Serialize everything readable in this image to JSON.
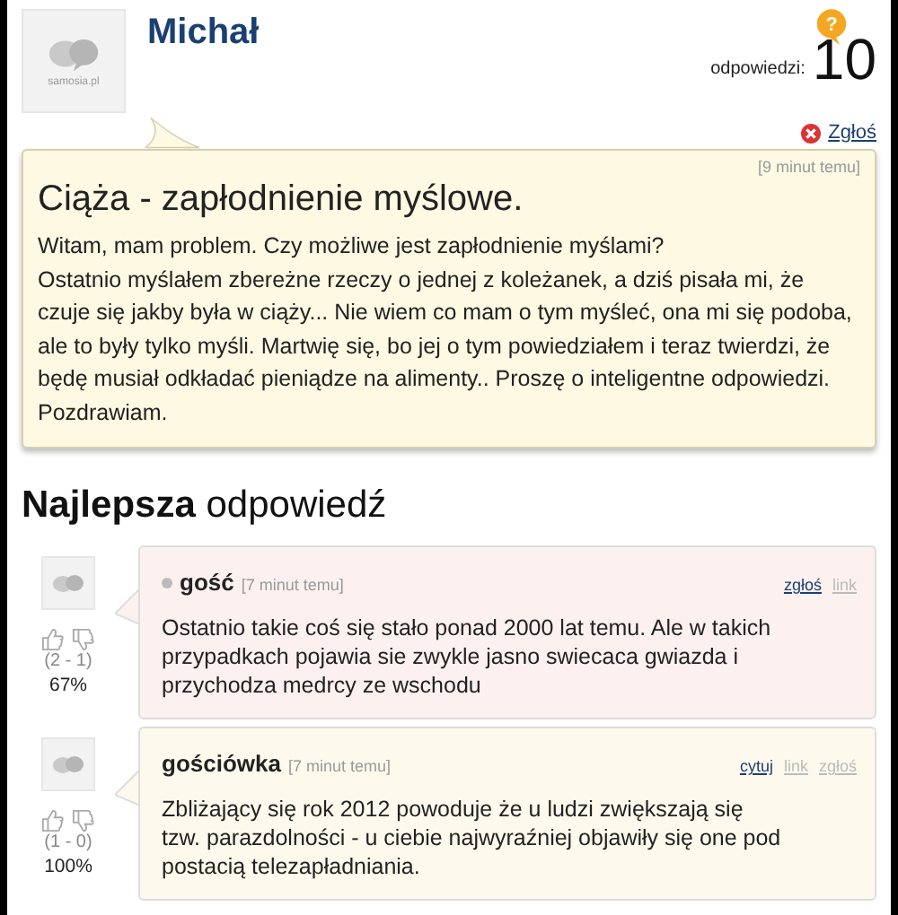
{
  "question": {
    "author": "Michał",
    "avatar_label": "samosia.pl",
    "answers_label": "odpowiedzi:",
    "answers_count": "10",
    "icon_text": "?",
    "report": "Zgłoś",
    "time": "[9 minut temu]",
    "title": "Ciąża - zapłodnienie myślowe.",
    "body": [
      "Witam, mam problem. Czy możliwe jest zapłodnienie myślami?",
      "Ostatnio myślałem zbereżne rzeczy o jednej z koleżanek, a dziś pisała mi, że czuje się jakby była w ciąży... Nie wiem co mam o tym myśleć, ona mi się podoba, ale to były tylko myśli. Martwię się, bo jej o tym powiedziałem i teraz twierdzi, że będę musiał odkładać pieniądze na alimenty.. Proszę o inteligentne odpowiedzi.",
      "Pozdrawiam."
    ]
  },
  "best_heading": {
    "bold": "Najlepsza",
    "rest": "odpowiedź"
  },
  "answers": [
    {
      "kind": "best",
      "author": "gość",
      "time": "[7 minut temu]",
      "votes": "(2 - 1)",
      "percent": "67%",
      "links": [
        {
          "label": "zgłoś",
          "active": true
        },
        {
          "label": "link",
          "active": false
        }
      ],
      "text": "Ostatnio takie coś się stało ponad 2000 lat temu. Ale w takich przypadkach pojawia sie zwykle jasno swiecaca gwiazda i przychodza medrcy ze wschodu"
    },
    {
      "kind": "regular",
      "author": "gościówka",
      "time": "[7 minut temu]",
      "votes": "(1 - 0)",
      "percent": "100%",
      "links": [
        {
          "label": "cytuj",
          "active": true
        },
        {
          "label": "link",
          "active": false
        },
        {
          "label": "zgłoś",
          "active": false
        }
      ],
      "text": "Zbliżający się rok 2012 powoduje że u ludzi zwiększają się tzw. parazdolności - u ciebie najwyraźniej objawiły się one pod postacią telezapładniania."
    }
  ]
}
